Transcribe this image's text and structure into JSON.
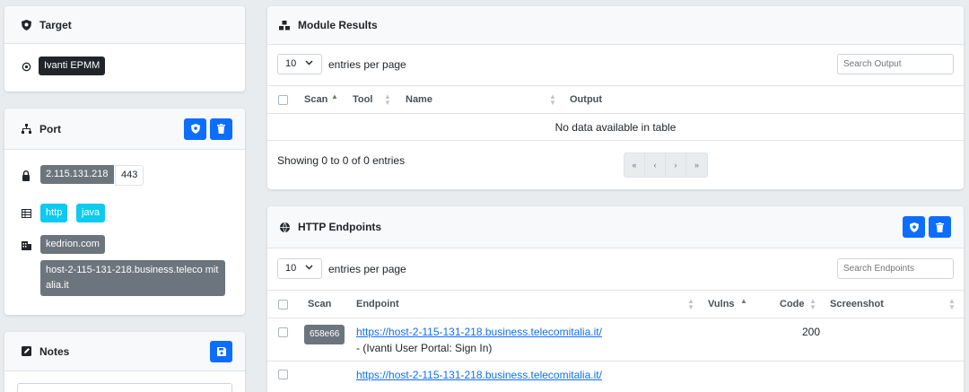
{
  "target": {
    "title": "Target",
    "value": "Ivanti EPMM"
  },
  "port": {
    "title": "Port",
    "ip": "2.115.131.218",
    "port_number": "443",
    "techs": [
      "http",
      "java"
    ],
    "hostnames": [
      "kedrion.com",
      "host-2-115-131-218.business.teleco mitalia.it"
    ]
  },
  "notes": {
    "title": "Notes"
  },
  "module_results": {
    "title": "Module Results",
    "page_size": "10",
    "entries_label": "entries per page",
    "search_placeholder": "Search Output",
    "columns": [
      "Scan",
      "Tool",
      "Name",
      "Output"
    ],
    "empty_text": "No data available in table",
    "showing_text": "Showing 0 to 0 of 0 entries",
    "pager": [
      "«",
      "‹",
      "›",
      "»"
    ]
  },
  "http_endpoints": {
    "title": "HTTP Endpoints",
    "page_size": "10",
    "entries_label": "entries per page",
    "search_placeholder": "Search Endpoints",
    "columns": [
      "Scan",
      "Endpoint",
      "Vulns",
      "Code",
      "Screenshot"
    ],
    "rows": [
      {
        "scan": "658e66",
        "endpoint": "https://host-2-115-131-218.business.telecomitalia.it/",
        "subtitle": "- (Ivanti User Portal: Sign In)",
        "code": "200"
      },
      {
        "scan": "",
        "endpoint": "https://host-2-115-131-218.business.telecomitalia.it/",
        "subtitle": "",
        "code": ""
      }
    ]
  },
  "colors": {
    "primary": "#0d6efd",
    "dark_badge": "#212529",
    "grey_badge": "#6c757d",
    "cyan_badge": "#0dcaf0",
    "background": "#e9ecef"
  },
  "icons": {
    "target": "shield-icon",
    "target_row": "crosshair-icon",
    "port": "sitemap-icon",
    "ip_row": "lock-icon",
    "tech_row": "table-icon",
    "host_row": "building-icon",
    "notes": "edit-icon",
    "module_results": "cubes-icon",
    "http_endpoints": "globe-icon"
  }
}
